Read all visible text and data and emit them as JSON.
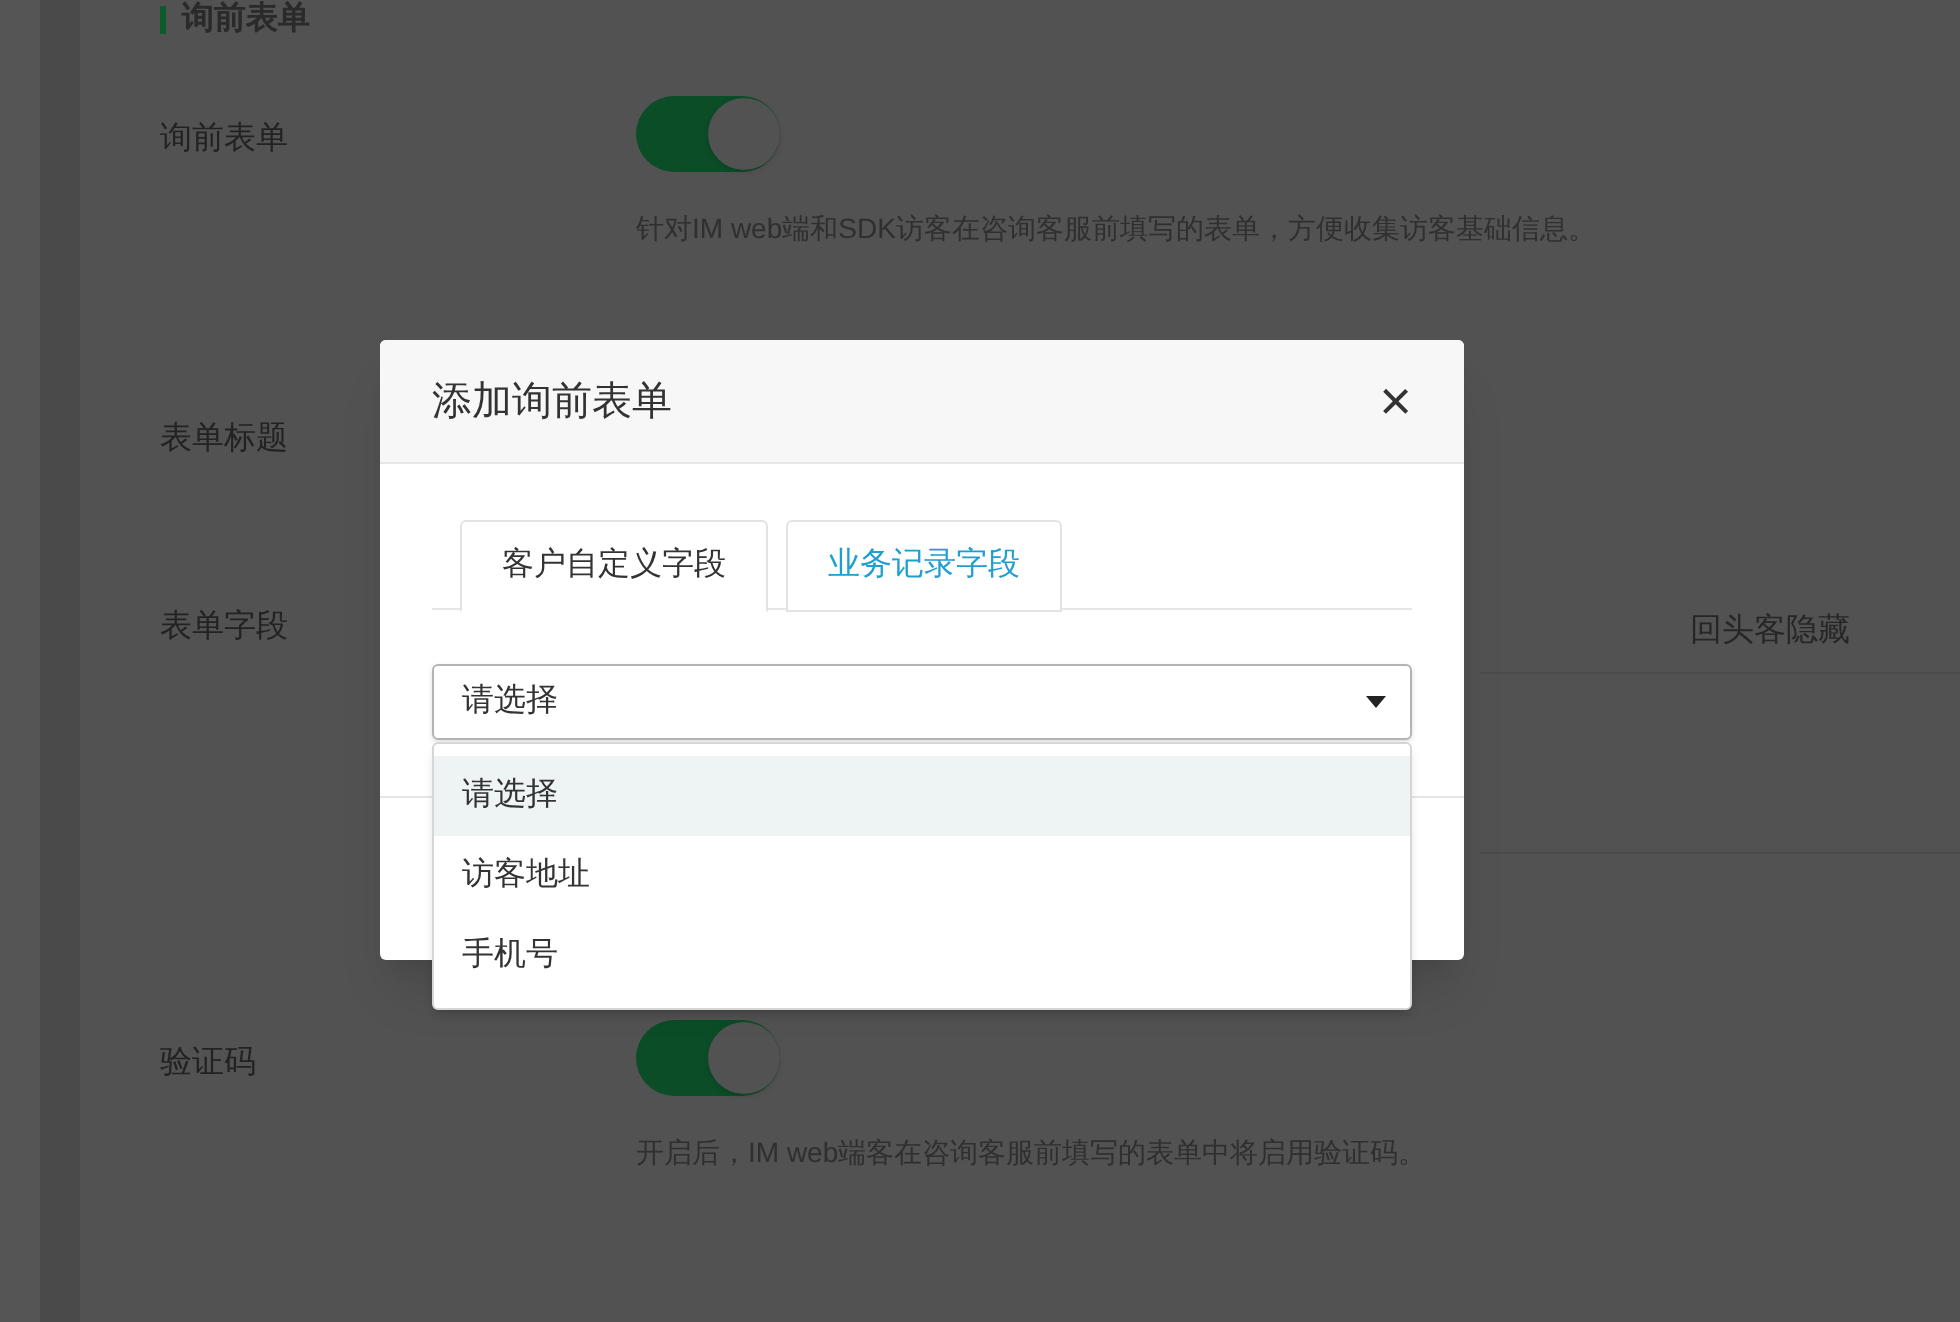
{
  "section_title": "询前表单",
  "settings": [
    {
      "kind": "toggle",
      "label": "询前表单",
      "on": true,
      "description": "针对IM web端和SDK访客在咨询客服前填写的表单，方便收集访客基础信息。"
    },
    {
      "kind": "text",
      "label": "表单标题"
    },
    {
      "kind": "fields",
      "label": "表单字段",
      "column_header": "回头客隐藏"
    },
    {
      "kind": "toggle",
      "label": "验证码",
      "on": true,
      "description": "开启后，IM web端客在咨询客服前填写的表单中将启用验证码。"
    }
  ],
  "modal": {
    "title": "添加询前表单",
    "close": "×",
    "tabs": [
      {
        "label": "客户自定义字段",
        "selected": true
      },
      {
        "label": "业务记录字段",
        "selected": false
      }
    ],
    "select": {
      "value": "请选择",
      "expanded": true,
      "options": [
        {
          "label": "请选择",
          "selected": true
        },
        {
          "label": "访客地址",
          "selected": false
        },
        {
          "label": "手机号",
          "selected": false
        }
      ]
    }
  }
}
